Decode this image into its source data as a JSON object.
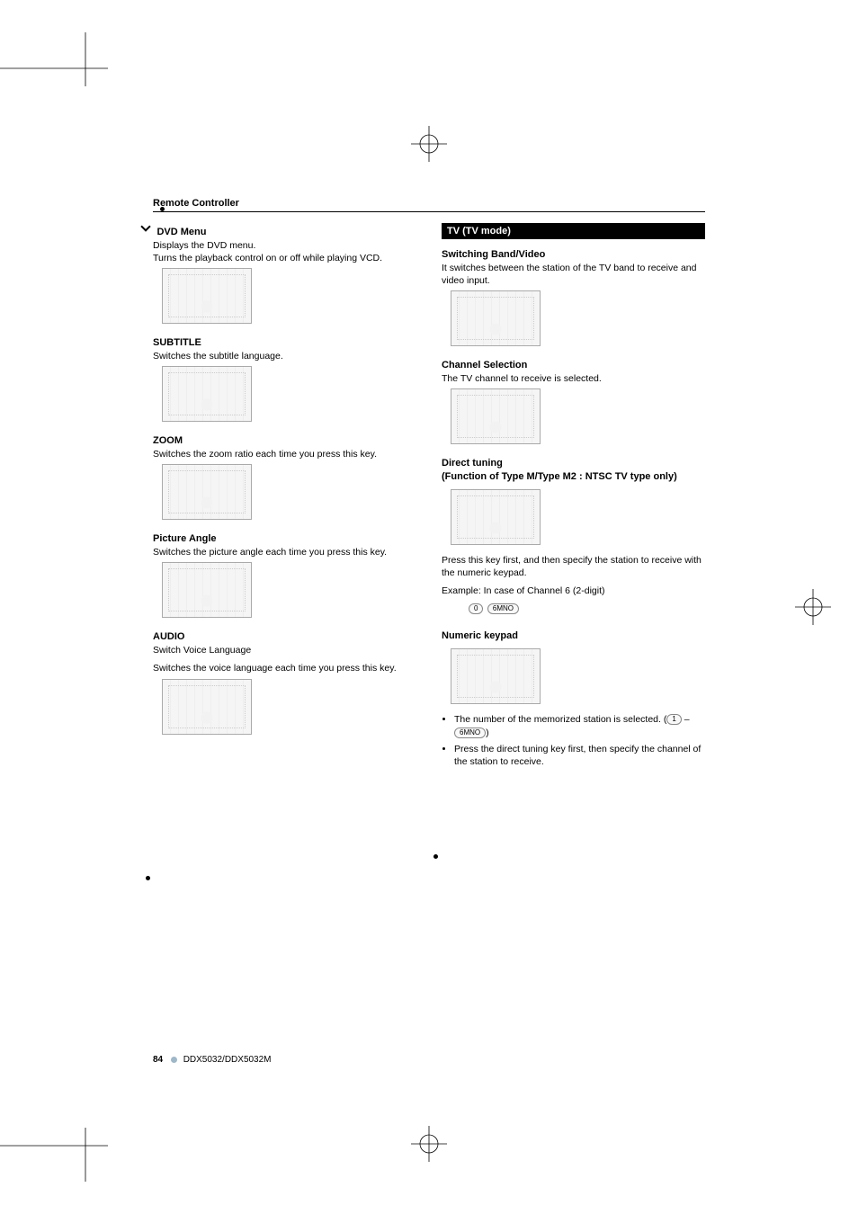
{
  "header": {
    "title": "Remote Controller"
  },
  "left": {
    "dvd_menu": {
      "title": "DVD Menu",
      "line1": "Displays the DVD menu.",
      "line2": "Turns the playback control on or off while playing VCD."
    },
    "subtitle": {
      "title": "SUBTITLE",
      "text": "Switches the subtitle language."
    },
    "zoom": {
      "title": "ZOOM",
      "text": "Switches the zoom ratio each time you press this key."
    },
    "picture_angle": {
      "title": "Picture Angle",
      "text": "Switches the picture angle each time you press this key."
    },
    "audio": {
      "title": "AUDIO",
      "sub": "Switch Voice Language",
      "text": "Switches the voice language each time you press this key."
    }
  },
  "right": {
    "topic": "TV (TV mode)",
    "switching": {
      "title": "Switching Band/Video",
      "text": "It switches between the station of the TV band to receive and video input."
    },
    "channel_sel": {
      "title": "Channel Selection",
      "text": "The TV channel to receive is selected."
    },
    "direct_tuning": {
      "title1": "Direct tuning",
      "title2": "(Function of Type M/Type M2 : NTSC TV type only)",
      "text": "Press this key first, and then specify the station to receive with the numeric keypad.",
      "example_label": "Example: In case of Channel 6 (2-digit)",
      "key0": "0",
      "key6": "6MNO"
    },
    "numeric_keypad": {
      "title": "Numeric keypad",
      "bullet1_a": "The number of the memorized station is selected. (",
      "bullet1_key1": "1",
      "bullet1_dash": " – ",
      "bullet1_key6": "6MNO",
      "bullet1_b": ")",
      "bullet2": "Press the direct tuning key first, then specify the channel of the station to receive."
    }
  },
  "footer": {
    "page_number": "84",
    "model": "DDX5032/DDX5032M"
  }
}
